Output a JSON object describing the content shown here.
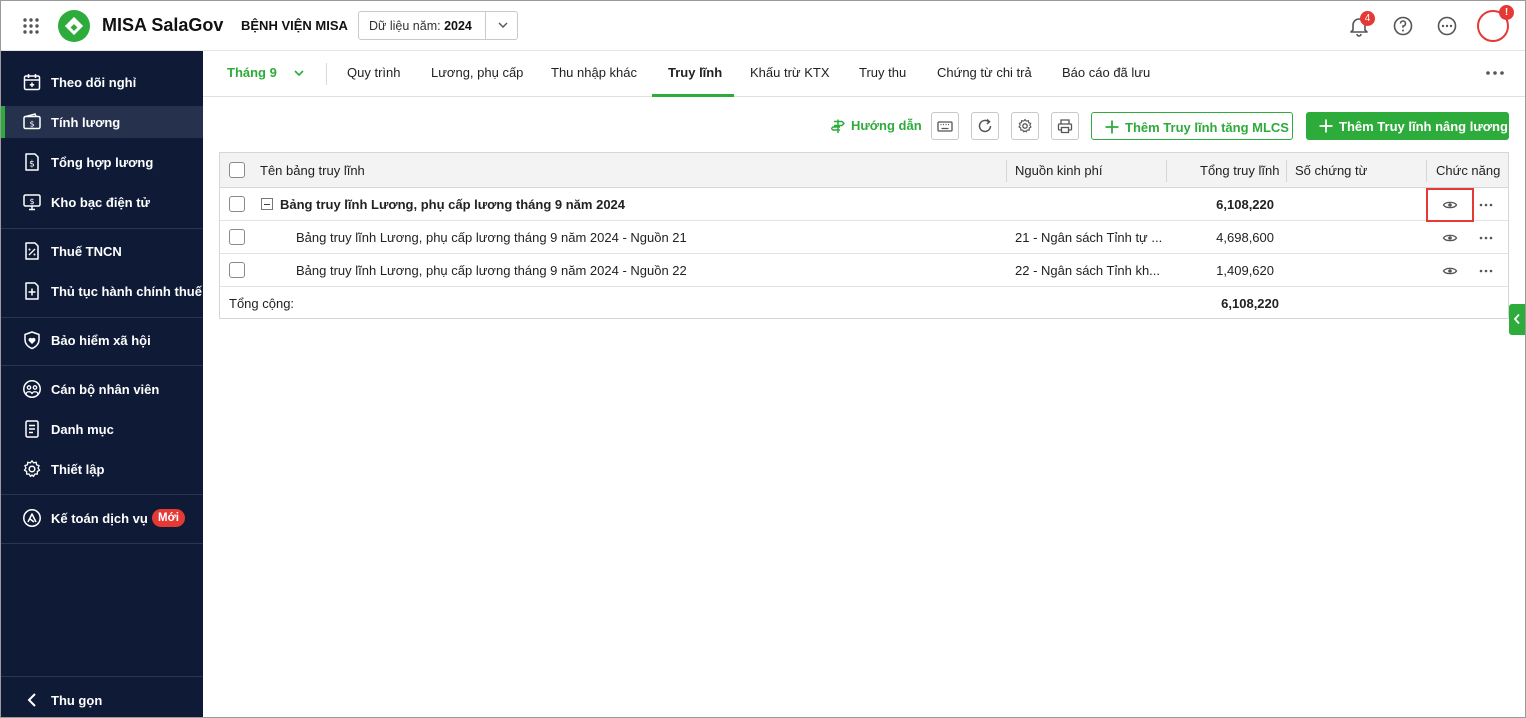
{
  "header": {
    "brand": "MISA SalaGov",
    "organization": "BỆNH VIỆN MISA",
    "year_label": "Dữ liệu năm:",
    "year_value": "2024",
    "notification_count": "4",
    "avatar_badge": "!"
  },
  "sidebar": {
    "items": [
      {
        "label": "Theo dõi nghỉ",
        "icon": "calendar-icon"
      },
      {
        "label": "Tính lương",
        "icon": "wallet-icon"
      },
      {
        "label": "Tổng hợp lương",
        "icon": "document-dollar-icon"
      },
      {
        "label": "Kho bạc điện tử",
        "icon": "monitor-dollar-icon"
      },
      {
        "label": "Thuế TNCN",
        "icon": "tax-document-icon"
      },
      {
        "label": "Thủ tục hành chính thuế",
        "icon": "document-plus-icon"
      },
      {
        "label": "Bảo hiểm xã hội",
        "icon": "shield-heart-icon"
      },
      {
        "label": "Cán bộ nhân viên",
        "icon": "people-icon"
      },
      {
        "label": "Danh mục",
        "icon": "list-document-icon"
      },
      {
        "label": "Thiết lập",
        "icon": "gear-icon"
      },
      {
        "label": "Kế toán dịch vụ",
        "icon": "accounting-service-icon"
      }
    ],
    "new_badge": "Mới",
    "collapse_label": "Thu gọn"
  },
  "tabs": {
    "month": "Tháng 9",
    "items": [
      "Quy trình",
      "Lương, phụ cấp",
      "Thu nhập khác",
      "Truy lĩnh",
      "Khấu trừ KTX",
      "Truy thu",
      "Chứng từ chi trả",
      "Báo cáo đã lưu"
    ],
    "active": "Truy lĩnh"
  },
  "toolbar": {
    "guide_label": "Hướng dẫn",
    "add_mlcs_label": "Thêm Truy lĩnh tăng MLCS",
    "add_raise_label": "Thêm Truy lĩnh nâng lương"
  },
  "table": {
    "columns": [
      "Tên bảng truy lĩnh",
      "Nguồn kinh phí",
      "Tổng truy lĩnh",
      "Số chứng từ",
      "Chức năng"
    ],
    "rows": [
      {
        "name": "Bảng truy lĩnh Lương, phụ cấp lương tháng 9 năm 2024",
        "source": "",
        "total": "6,108,220",
        "doc": ""
      },
      {
        "name": "Bảng truy lĩnh Lương, phụ cấp lương tháng 9 năm 2024 - Nguồn 21",
        "source": "21 - Ngân sách Tỉnh tự ...",
        "total": "4,698,600",
        "doc": ""
      },
      {
        "name": "Bảng truy lĩnh Lương, phụ cấp lương tháng 9 năm 2024 - Nguồn 22",
        "source": "22 - Ngân sách Tỉnh kh...",
        "total": "1,409,620",
        "doc": ""
      }
    ],
    "footer_label": "Tổng cộng:",
    "footer_total": "6,108,220"
  },
  "colors": {
    "accent": "#2dab3b",
    "sidebar_bg": "#0f1a36",
    "sidebar_active": "#26314e",
    "alert": "#e53935"
  }
}
